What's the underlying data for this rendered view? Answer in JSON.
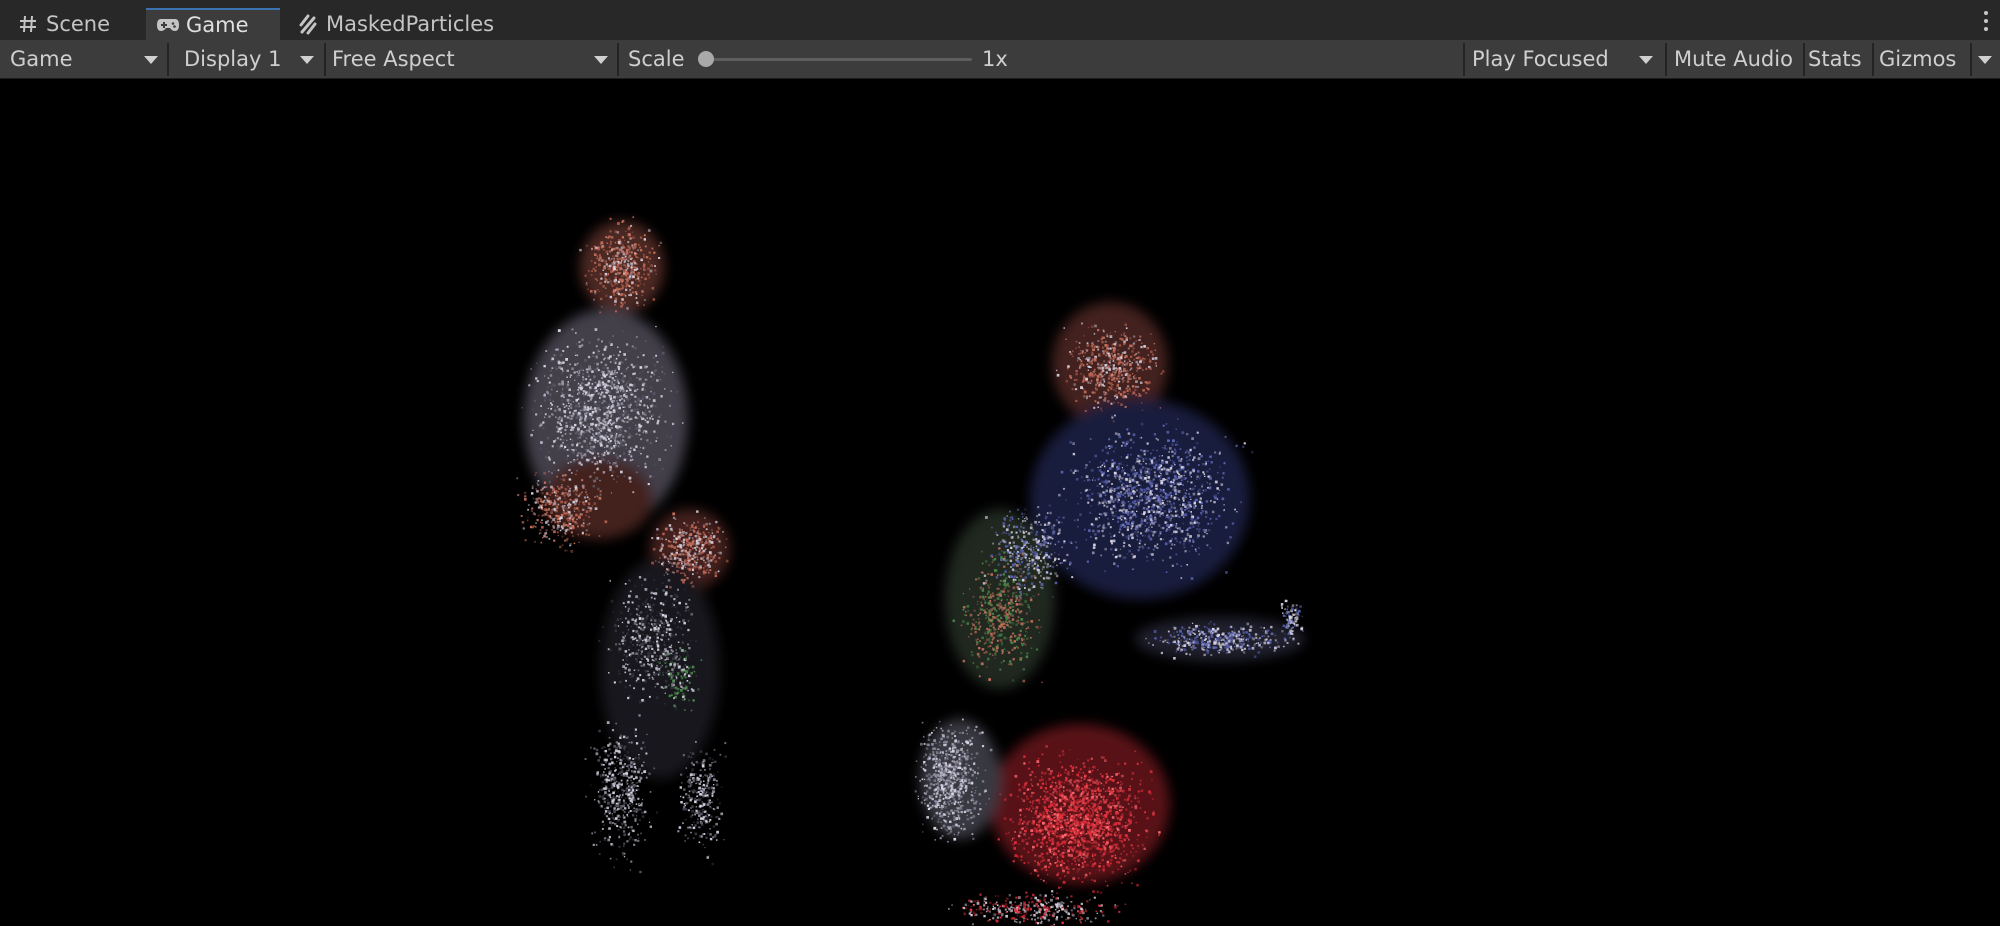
{
  "tabs": [
    {
      "label": "Scene",
      "icon": "grid-hash-icon",
      "active": false
    },
    {
      "label": "Game",
      "icon": "gamepad-icon",
      "active": true
    },
    {
      "label": "MaskedParticles",
      "icon": "particles-icon",
      "active": false
    }
  ],
  "toolbar": {
    "view_select": "Game",
    "display_select": "Display 1",
    "aspect_select": "Free Aspect",
    "scale_label": "Scale",
    "scale_value": "1x",
    "play_mode_select": "Play Focused",
    "mute_audio_label": "Mute Audio",
    "stats_label": "Stats",
    "gizmos_label": "Gizmos"
  },
  "colors": {
    "tab_bar_bg": "#282828",
    "toolbar_bg": "#3c3c3c",
    "active_tab_accent": "#3a72b0",
    "game_bg": "#000000",
    "particle_white": "#d8d4e4",
    "particle_salmon": "#c8705c",
    "particle_blue": "#5a64b4",
    "particle_red": "#e0303c",
    "particle_green": "#4a8a4a"
  }
}
